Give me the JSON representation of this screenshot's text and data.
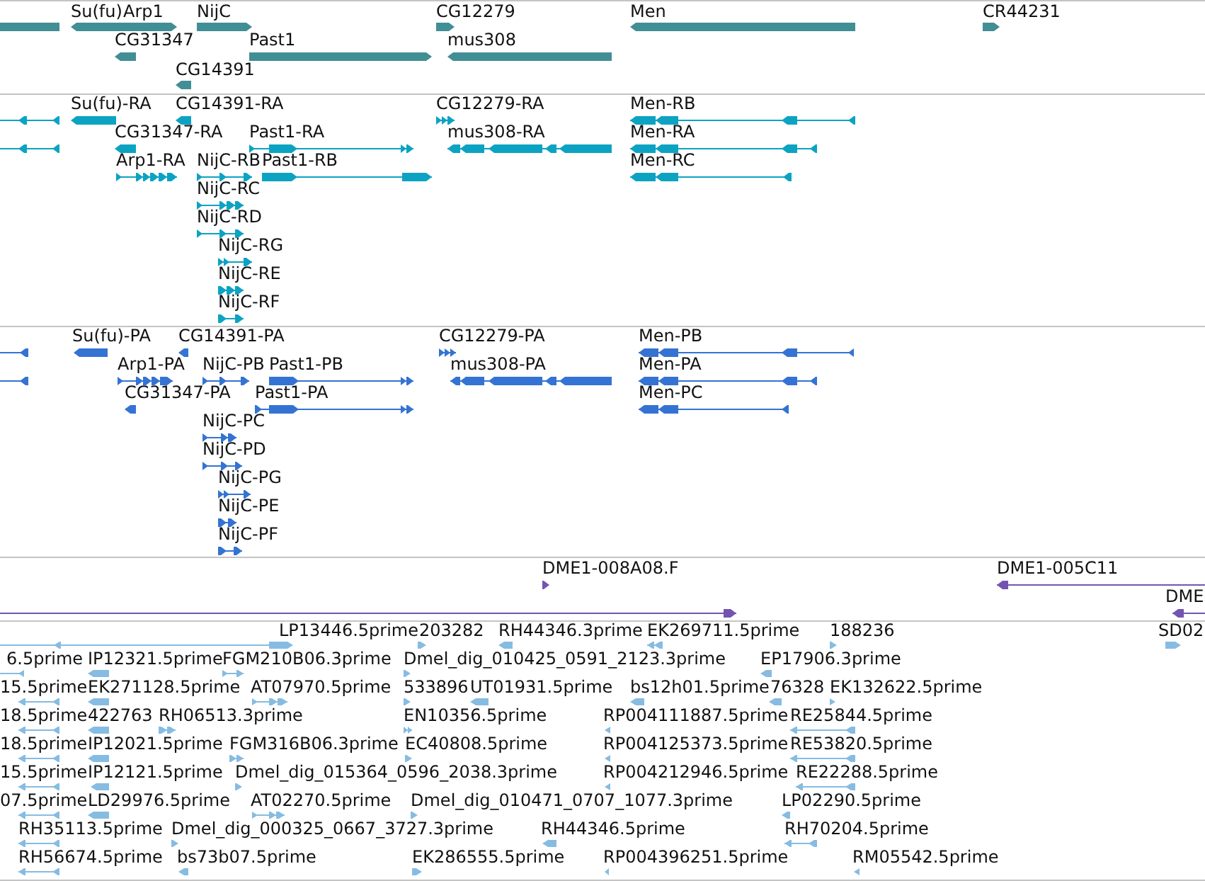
{
  "tracks": [
    {
      "color": "#418e95",
      "features": [
        {
          "forward": false
        },
        {
          "label": "Su(fu)",
          "forward": false
        },
        {
          "label": "Arp1",
          "forward": true
        },
        {
          "label": "NijC",
          "forward": true
        },
        {
          "label": "CG12279",
          "forward": true
        },
        {
          "label": "Men",
          "forward": false
        },
        {
          "label": "CR44231",
          "forward": true
        },
        {
          "label": "CG31347",
          "forward": false
        },
        {
          "label": "Past1",
          "forward": true
        },
        {
          "label": "mus308",
          "forward": false
        },
        {
          "label": "CG14391",
          "forward": false
        }
      ]
    },
    {
      "color": "#0ca3c3",
      "features": [
        {
          "forward": false
        },
        {
          "label": "Su(fu)-RA",
          "forward": false
        },
        {
          "label": "CG14391-RA",
          "forward": false
        },
        {
          "label": "CG12279-RA",
          "forward": true
        },
        {
          "label": "Men-RB",
          "forward": false
        },
        {
          "forward": false
        },
        {
          "label": "CG31347-RA",
          "forward": false
        },
        {
          "label": "Past1-RA",
          "forward": true
        },
        {
          "label": "mus308-RA",
          "forward": false
        },
        {
          "label": "Men-RA",
          "forward": false
        },
        {
          "label": "Arp1-RA",
          "forward": true
        },
        {
          "label": "NijC-RB",
          "forward": true
        },
        {
          "label": "Past1-RB",
          "forward": true
        },
        {
          "label": "Men-RC",
          "forward": false
        },
        {
          "label": "NijC-RC",
          "forward": true
        },
        {
          "label": "NijC-RD",
          "forward": true
        },
        {
          "label": "NijC-RG",
          "forward": true
        },
        {
          "label": "NijC-RE",
          "forward": true
        },
        {
          "label": "NijC-RF",
          "forward": true
        }
      ]
    },
    {
      "color": "#3473d3",
      "features": [
        {
          "forward": false
        },
        {
          "label": "Su(fu)-PA",
          "forward": false
        },
        {
          "label": "CG14391-PA",
          "forward": false
        },
        {
          "label": "CG12279-PA",
          "forward": true
        },
        {
          "label": "Men-PB",
          "forward": false
        },
        {
          "forward": false
        },
        {
          "label": "Arp1-PA",
          "forward": true
        },
        {
          "label": "NijC-PB",
          "forward": true
        },
        {
          "label": "Past1-PB",
          "forward": true
        },
        {
          "label": "mus308-PA",
          "forward": false
        },
        {
          "label": "Men-PA",
          "forward": false
        },
        {
          "label": "CG31347-PA",
          "forward": false
        },
        {
          "label": "Past1-PA",
          "forward": true
        },
        {
          "label": "Men-PC",
          "forward": false
        },
        {
          "label": "NijC-PC",
          "forward": true
        },
        {
          "label": "NijC-PD",
          "forward": true
        },
        {
          "label": "NijC-PG",
          "forward": true
        },
        {
          "label": "NijC-PE",
          "forward": true
        },
        {
          "label": "NijC-PF",
          "forward": true
        }
      ]
    },
    {
      "color": "#7355b1",
      "features": [
        {
          "label": "DME1-008A08.F",
          "forward": true
        },
        {
          "label": "DME1-005C11",
          "forward": false
        },
        {
          "forward": true
        },
        {
          "label": "DME",
          "forward": false
        }
      ]
    },
    {
      "color": "#86bce2",
      "features": [
        {
          "forward": false
        },
        {
          "label": "LP13446.5prime",
          "forward": true
        },
        {
          "label": "203282",
          "forward": true
        },
        {
          "label": "RH44346.3prime",
          "forward": false
        },
        {
          "label": "EK269711.5prime",
          "forward": false
        },
        {
          "label": "188236",
          "forward": true
        },
        {
          "label": "SD02",
          "forward": true
        },
        {
          "label": "6.5prime",
          "forward": false
        },
        {
          "label": "IP12321.5prime",
          "forward": false
        },
        {
          "label": "FGM210B06.3prime",
          "forward": true
        },
        {
          "label": "Dmel_dig_010425_0591_2123.3prime",
          "forward": true
        },
        {
          "label": "EP17906.3prime",
          "forward": false
        },
        {
          "label": "15.5prime",
          "forward": false
        },
        {
          "label": "EK271128.5prime",
          "forward": false
        },
        {
          "label": "AT07970.5prime",
          "forward": true
        },
        {
          "label": "533896",
          "forward": true
        },
        {
          "label": "UT01931.5prime",
          "forward": false
        },
        {
          "label": "bs12h01.5prime",
          "forward": false
        },
        {
          "label": "76328",
          "forward": false
        },
        {
          "label": "EK132622.5prime",
          "forward": true
        },
        {
          "label": "18.5prime",
          "forward": false
        },
        {
          "label": "422763",
          "forward": false
        },
        {
          "label": "RH06513.3prime",
          "forward": true
        },
        {
          "label": "EN10356.5prime",
          "forward": true
        },
        {
          "label": "RP004111887.5prime",
          "forward": false
        },
        {
          "label": "RE25844.5prime",
          "forward": false
        },
        {
          "label": "18.5prime",
          "forward": false
        },
        {
          "label": "IP12021.5prime",
          "forward": false
        },
        {
          "label": "FGM316B06.3prime",
          "forward": true
        },
        {
          "label": "EC40808.5prime",
          "forward": true
        },
        {
          "label": "RP004125373.5prime",
          "forward": false
        },
        {
          "label": "RE53820.5prime",
          "forward": false
        },
        {
          "label": "15.5prime",
          "forward": false
        },
        {
          "label": "IP12121.5prime",
          "forward": false
        },
        {
          "label": "Dmel_dig_015364_0596_2038.3prime",
          "forward": true
        },
        {
          "label": "RP004212946.5prime",
          "forward": false
        },
        {
          "label": "RE22288.5prime",
          "forward": false
        },
        {
          "label": "07.5prime",
          "forward": false
        },
        {
          "label": "LD29976.5prime",
          "forward": false
        },
        {
          "label": "AT02270.5prime",
          "forward": true
        },
        {
          "label": "Dmel_dig_010471_0707_1077.3prime",
          "forward": true
        },
        {
          "label": "LP02290.5prime",
          "forward": false
        },
        {
          "label": "RH35113.5prime",
          "forward": false
        },
        {
          "label": "Dmel_dig_000325_0667_3727.3prime",
          "forward": true
        },
        {
          "label": "RH44346.5prime",
          "forward": false
        },
        {
          "label": "RH70204.5prime",
          "forward": false
        },
        {
          "label": "RH56674.5prime",
          "forward": false
        },
        {
          "label": "bs73b07.5prime",
          "forward": false
        },
        {
          "label": "EK286555.5prime",
          "forward": true
        },
        {
          "label": "RP004396251.5prime",
          "forward": false
        },
        {
          "label": "RM05542.5prime",
          "forward": false
        }
      ]
    }
  ]
}
